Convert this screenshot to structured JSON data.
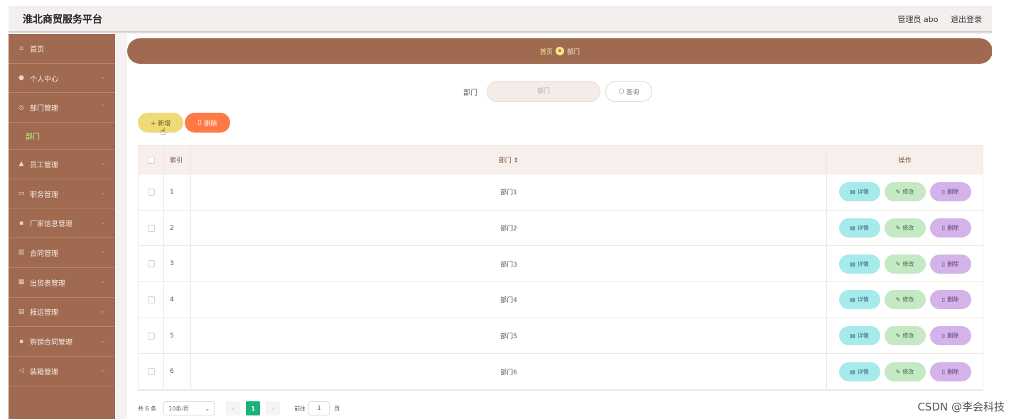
{
  "app": {
    "title": "淮北商贸服务平台"
  },
  "topbar": {
    "user": "管理员 abo",
    "logout": "退出登录"
  },
  "sidebar": {
    "items": [
      {
        "label": "首页",
        "icon": "home-icon",
        "chevron": false
      },
      {
        "label": "个人中心",
        "icon": "user-icon",
        "chevron": true
      },
      {
        "label": "部门管理",
        "icon": "circle-icon",
        "chevron": true
      },
      {
        "label": "员工管理",
        "icon": "lock-icon",
        "chevron": true
      },
      {
        "label": "职务管理",
        "icon": "screen-icon",
        "chevron": true
      },
      {
        "label": "厂家信息管理",
        "icon": "doc-icon",
        "chevron": true
      },
      {
        "label": "合同管理",
        "icon": "bar-chart-icon",
        "chevron": true
      },
      {
        "label": "出货表管理",
        "icon": "chart-icon",
        "chevron": true
      },
      {
        "label": "报运管理",
        "icon": "grid-icon",
        "chevron": true
      },
      {
        "label": "购销合同管理",
        "icon": "doc-icon",
        "chevron": true
      },
      {
        "label": "装箱管理",
        "icon": "send-icon",
        "chevron": true
      }
    ],
    "sub_active": "部门"
  },
  "breadcrumb": {
    "home": "首页",
    "current": "部门"
  },
  "search": {
    "label": "部门",
    "placeholder": "部门",
    "button": "查询"
  },
  "actions": {
    "add": "+ 新增",
    "delete": "删除"
  },
  "table": {
    "headers": {
      "index": "索引",
      "dept": "部门 ⇕",
      "op": "操作"
    },
    "rows": [
      {
        "index": "1",
        "dept": "部门1"
      },
      {
        "index": "2",
        "dept": "部门2"
      },
      {
        "index": "3",
        "dept": "部门3"
      },
      {
        "index": "4",
        "dept": "部门4"
      },
      {
        "index": "5",
        "dept": "部门5"
      },
      {
        "index": "6",
        "dept": "部门6"
      }
    ],
    "row_actions": {
      "detail": "详情",
      "edit": "修改",
      "delete": "删除"
    }
  },
  "pagination": {
    "total": "共 6 条",
    "page_size": "10条/页",
    "current_page": "1",
    "goto_label": "前往",
    "goto_value": "1",
    "page_suffix": "页"
  },
  "watermark": "CSDN @李会科技",
  "colors": {
    "sidebar": "#9f6a50",
    "accent_active": "#1bb17a",
    "add_button": "#eedb78",
    "delete_button": "#ff7a45"
  }
}
